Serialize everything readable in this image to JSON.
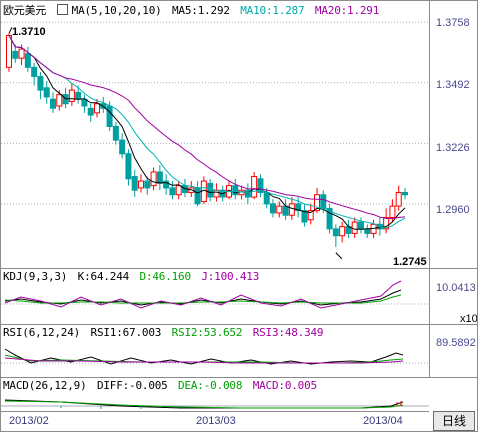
{
  "main": {
    "symbol": "欧元美元",
    "ma_label": "MA(5,10,20,10)",
    "ma5": "MA5:1.292",
    "ma10": "MA10:1.287",
    "ma20": "MA20:1.291",
    "y_ticks": [
      "1.3758",
      "1.3492",
      "1.3226",
      "1.2960"
    ],
    "high_label": "1.3710",
    "low_label": "1.2745",
    "colors": {
      "ma5": "#000000",
      "ma10": "#00b3b3",
      "ma20": "#a000a0",
      "up": "#ff0000",
      "down": "#00a0a0"
    }
  },
  "kdj": {
    "label": "KDJ(9,3,3)",
    "k": "K:64.244",
    "d": "D:46.160",
    "j": "J:100.413",
    "tick": "10.0413",
    "scale": "x10"
  },
  "rsi": {
    "label": "RSI(6,12,24)",
    "rsi1": "RSI1:67.003",
    "rsi2": "RSI2:53.652",
    "rsi3": "RSI3:48.349",
    "tick": "89.5892"
  },
  "macd": {
    "label": "MACD(26,12,9)",
    "diff": "DIFF:-0.005",
    "dea": "DEA:-0.008",
    "macd": "MACD:0.005"
  },
  "dates": [
    "2013/02",
    "2013/03",
    "2013/04"
  ],
  "button_label": "日线",
  "chart_data": {
    "type": "candlestick",
    "title": "欧元美元",
    "ylim": [
      1.27,
      1.379
    ],
    "y_ticks": [
      1.3758,
      1.3492,
      1.3226,
      1.296
    ],
    "annotated_high": 1.371,
    "annotated_low": 1.2745,
    "candles": [
      [
        1.356,
        1.37,
        1.371,
        1.354
      ],
      [
        1.363,
        1.36,
        1.366,
        1.358
      ],
      [
        1.36,
        1.364,
        1.366,
        1.357
      ],
      [
        1.362,
        1.356,
        1.365,
        1.354
      ],
      [
        1.356,
        1.352,
        1.358,
        1.348
      ],
      [
        1.352,
        1.346,
        1.354,
        1.342
      ],
      [
        1.347,
        1.343,
        1.35,
        1.34
      ],
      [
        1.342,
        1.338,
        1.345,
        1.336
      ],
      [
        1.339,
        1.344,
        1.346,
        1.337
      ],
      [
        1.344,
        1.34,
        1.347,
        1.338
      ],
      [
        1.341,
        1.346,
        1.349,
        1.339
      ],
      [
        1.345,
        1.342,
        1.348,
        1.34
      ],
      [
        1.342,
        1.339,
        1.344,
        1.336
      ],
      [
        1.338,
        1.335,
        1.34,
        1.332
      ],
      [
        1.336,
        1.34,
        1.342,
        1.334
      ],
      [
        1.34,
        1.338,
        1.343,
        1.336
      ],
      [
        1.339,
        1.33,
        1.341,
        1.328
      ],
      [
        1.33,
        1.324,
        1.332,
        1.322
      ],
      [
        1.324,
        1.318,
        1.327,
        1.316
      ],
      [
        1.318,
        1.307,
        1.32,
        1.304
      ],
      [
        1.308,
        1.302,
        1.311,
        1.299
      ],
      [
        1.303,
        1.306,
        1.309,
        1.301
      ],
      [
        1.306,
        1.303,
        1.308,
        1.3
      ],
      [
        1.304,
        1.31,
        1.312,
        1.302
      ],
      [
        1.31,
        1.305,
        1.313,
        1.302
      ],
      [
        1.306,
        1.303,
        1.309,
        1.3
      ],
      [
        1.303,
        1.3,
        1.306,
        1.298
      ],
      [
        1.3,
        1.304,
        1.306,
        1.298
      ],
      [
        1.304,
        1.301,
        1.307,
        1.299
      ],
      [
        1.301,
        1.303,
        1.306,
        1.299
      ],
      [
        1.303,
        1.296,
        1.306,
        1.295
      ],
      [
        1.297,
        1.306,
        1.308,
        1.296
      ],
      [
        1.305,
        1.299,
        1.307,
        1.297
      ],
      [
        1.299,
        1.302,
        1.305,
        1.297
      ],
      [
        1.302,
        1.299,
        1.304,
        1.297
      ],
      [
        1.299,
        1.304,
        1.306,
        1.298
      ],
      [
        1.304,
        1.3,
        1.307,
        1.298
      ],
      [
        1.3,
        1.302,
        1.304,
        1.298
      ],
      [
        1.302,
        1.299,
        1.305,
        1.296
      ],
      [
        1.299,
        1.308,
        1.31,
        1.298
      ],
      [
        1.307,
        1.301,
        1.309,
        1.299
      ],
      [
        1.301,
        1.296,
        1.303,
        1.294
      ],
      [
        1.296,
        1.292,
        1.298,
        1.29
      ],
      [
        1.292,
        1.295,
        1.297,
        1.29
      ],
      [
        1.295,
        1.291,
        1.298,
        1.289
      ],
      [
        1.291,
        1.296,
        1.299,
        1.289
      ],
      [
        1.296,
        1.293,
        1.299,
        1.29
      ],
      [
        1.293,
        1.288,
        1.296,
        1.286
      ],
      [
        1.289,
        1.293,
        1.296,
        1.287
      ],
      [
        1.293,
        1.3,
        1.303,
        1.292
      ],
      [
        1.3,
        1.294,
        1.302,
        1.292
      ],
      [
        1.294,
        1.285,
        1.296,
        1.283
      ],
      [
        1.285,
        1.282,
        1.287,
        1.277
      ],
      [
        1.282,
        1.286,
        1.288,
        1.279
      ],
      [
        1.286,
        1.283,
        1.289,
        1.281
      ],
      [
        1.283,
        1.288,
        1.29,
        1.281
      ],
      [
        1.288,
        1.285,
        1.29,
        1.283
      ],
      [
        1.285,
        1.283,
        1.287,
        1.281
      ],
      [
        1.283,
        1.287,
        1.289,
        1.281
      ],
      [
        1.287,
        1.285,
        1.29,
        1.282
      ],
      [
        1.285,
        1.29,
        1.294,
        1.283
      ],
      [
        1.29,
        1.295,
        1.298,
        1.288
      ],
      [
        1.295,
        1.301,
        1.304,
        1.293
      ],
      [
        1.301,
        1.3,
        1.303,
        1.298
      ]
    ]
  }
}
